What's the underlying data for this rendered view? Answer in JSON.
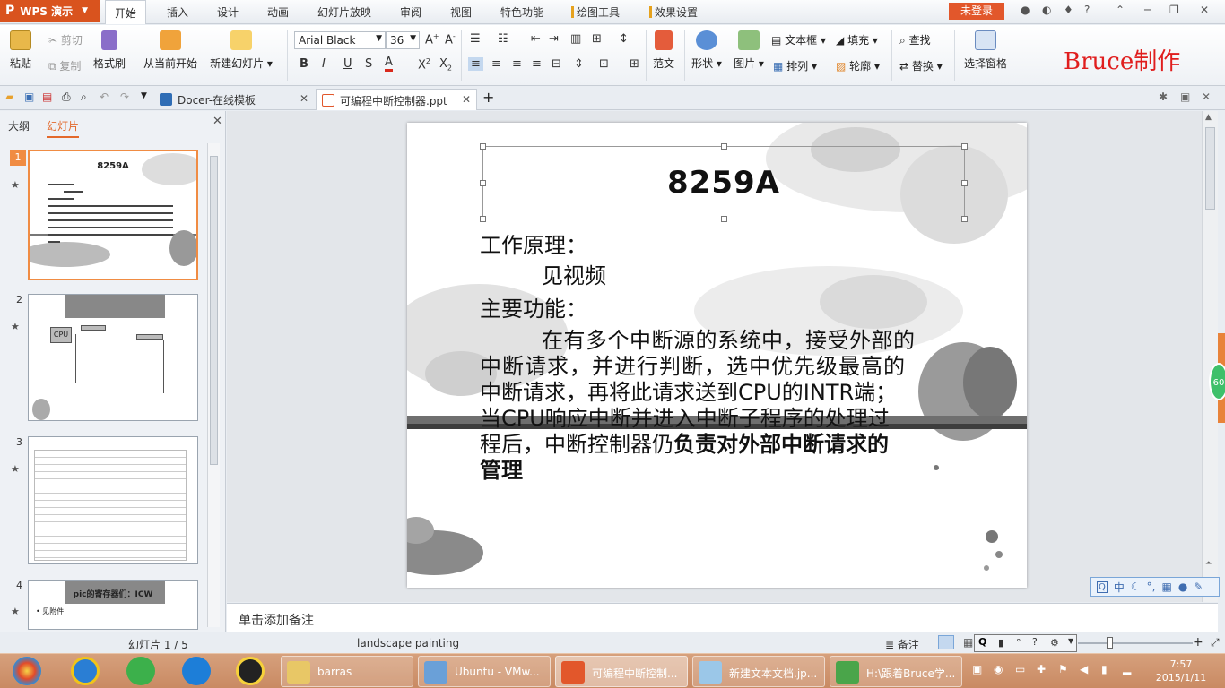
{
  "app": {
    "name": "WPS 演示",
    "login": "未登录",
    "watermark": "Bruce制作"
  },
  "menu": [
    "开始",
    "插入",
    "设计",
    "动画",
    "幻灯片放映",
    "审阅",
    "视图",
    "特色功能",
    "绘图工具",
    "效果设置"
  ],
  "ribbon": {
    "paste": "粘贴",
    "cut": "剪切",
    "copy": "复制",
    "format_painter": "格式刷",
    "from_current": "从当前开始",
    "new_slide": "新建幻灯片",
    "font_name": "Arial Black",
    "font_size": "36",
    "fanwen": "范文",
    "shape": "形状",
    "picture": "图片",
    "textbox": "文本框",
    "fill": "填充",
    "find": "查找",
    "arrange": "排列",
    "outline": "轮廓",
    "replace": "替换",
    "select_pane": "选择窗格"
  },
  "tabs": [
    {
      "label": "Docer-在线模板",
      "color": "#2f6db5"
    },
    {
      "label": "可编程中断控制器.ppt",
      "color": "#e2572b"
    }
  ],
  "left_panel": {
    "tab_outline": "大纲",
    "tab_slides": "幻灯片",
    "slides": [
      {
        "num": "1",
        "title": "8259A"
      },
      {
        "num": "2",
        "label": "CPU"
      },
      {
        "num": "3"
      },
      {
        "num": "4",
        "title": "pic的寄存器们：ICW",
        "bullet": "• 见附件"
      }
    ]
  },
  "slide": {
    "title": "8259A",
    "heading1": "工作原理：",
    "line1": "见视频",
    "heading2": "主要功能：",
    "para_l1": "在有多个中断源的系统中，接受外部的",
    "para_l2": "中断请求，并进行判断，选中优先级最高的",
    "para_l3": "中断请求，再将此请求送到CPU的INTR端；",
    "para_l4": "当CPU响应中断并进入中断子程序的处理过",
    "para_l5a": "程后，中断控制器仍",
    "para_l5b": "负责对外部中断请求的",
    "para_l6": "管理"
  },
  "notes_placeholder": "单击添加备注",
  "status": {
    "slide_count": "幻灯片 1 / 5",
    "theme": "landscape painting",
    "notes": "备注"
  },
  "ime": [
    "中",
    "°,"
  ],
  "taskbar": {
    "items": [
      "barras",
      "Ubuntu - VMw...",
      "可编程中断控制...",
      "新建文本文档.jp...",
      "H:\\跟着Bruce学..."
    ],
    "time": "7:57",
    "date": "2015/1/11"
  },
  "side_badge": "60"
}
